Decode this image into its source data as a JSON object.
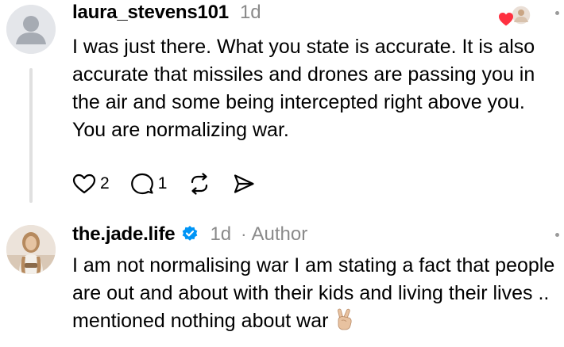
{
  "comments": [
    {
      "username": "laura_stevens101",
      "time": "1d",
      "text": "I was just there. What you state is accurate. It is also accurate that missiles and drones are passing you in the air and some being intercepted right above you. You are normalizing war.",
      "likes_count": "2",
      "replies_count": "1",
      "icons": {
        "avatar": "default-avatar-icon",
        "liked_by": "heart-with-avatar-icon",
        "like": "heart-icon",
        "reply": "speech-bubble-icon",
        "repost": "repost-icon",
        "share": "send-icon",
        "more": "more-dots-icon"
      }
    },
    {
      "username": "the.jade.life",
      "verified": true,
      "time": "1d",
      "separator": "·",
      "author_tag": "Author",
      "text": "I am not normalising war I am stating a fact that people are out and about with their kids and living their lives .. mentioned nothing about war",
      "emoji": "victory-hand-emoji",
      "icons": {
        "avatar": "profile-photo",
        "verified": "verified-badge-icon",
        "more": "more-dots-icon"
      }
    }
  ],
  "colors": {
    "text": "#000000",
    "muted": "#8a8a8a",
    "verified_blue": "#0095f6",
    "heart_red": "#ff3040",
    "thread_line": "#e0e0e0"
  }
}
